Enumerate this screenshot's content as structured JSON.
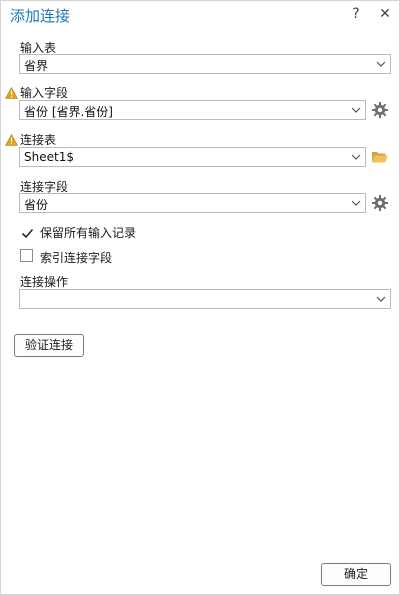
{
  "dialog": {
    "title": "添加连接",
    "help_label": "?",
    "close_label": "✕"
  },
  "input_table": {
    "label": "输入表",
    "value": "省界"
  },
  "input_field": {
    "label": "输入字段",
    "value": "省份 [省界.省份]",
    "warning": true
  },
  "join_table": {
    "label": "连接表",
    "value": "Sheet1$",
    "warning": true
  },
  "join_field": {
    "label": "连接字段",
    "value": "省份"
  },
  "options": {
    "keep_all": {
      "label": "保留所有输入记录",
      "checked": true
    },
    "index_join": {
      "label": "索引连接字段",
      "checked": false
    }
  },
  "join_operation": {
    "label": "连接操作",
    "value": ""
  },
  "buttons": {
    "validate": "验证连接",
    "ok": "确定"
  },
  "colors": {
    "title": "#1f7ab8",
    "warning": "#e2a520",
    "folder": "#e8b64a"
  }
}
